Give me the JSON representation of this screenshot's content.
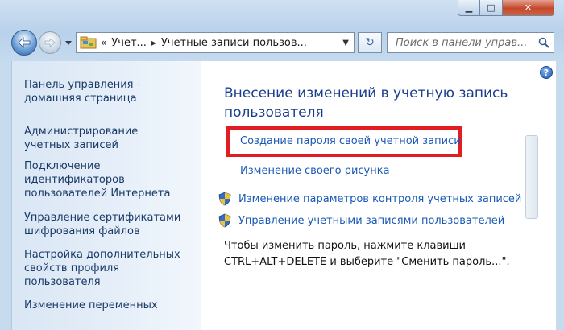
{
  "window": {
    "minimize_glyph": "▁",
    "maximize_glyph": "□",
    "close_glyph": "✕"
  },
  "nav": {
    "breadcrumbs": [
      "Учет...",
      "Учетные записи пользов..."
    ],
    "breadcrumb_sep": "▸",
    "lead_sep": "«",
    "refresh_glyph": "↻",
    "search_placeholder": "Поиск в панели управ..."
  },
  "sidebar": {
    "links": [
      "Панель управления - домашняя страница",
      "Администрирование учетных записей",
      "Подключение идентификаторов пользователей Интернета",
      "Управление сертификатами шифрования файлов",
      "Настройка дополнительных свойств профиля пользователя",
      "Изменение переменных"
    ]
  },
  "main": {
    "help_glyph": "?",
    "heading": "Внесение изменений в учетную запись пользователя",
    "tasks": [
      "Создание пароля своей учетной записи",
      "Изменение своего рисунка",
      "Изменение параметров контроля учетных записей",
      "Управление учетными записями пользователей"
    ],
    "note": "Чтобы изменить пароль, нажмите клавиши CTRL+ALT+DELETE и выберите \"Сменить пароль...\"."
  },
  "colors": {
    "link": "#1a59b3",
    "heading": "#1b3e8c",
    "highlight": "#e11d23"
  }
}
